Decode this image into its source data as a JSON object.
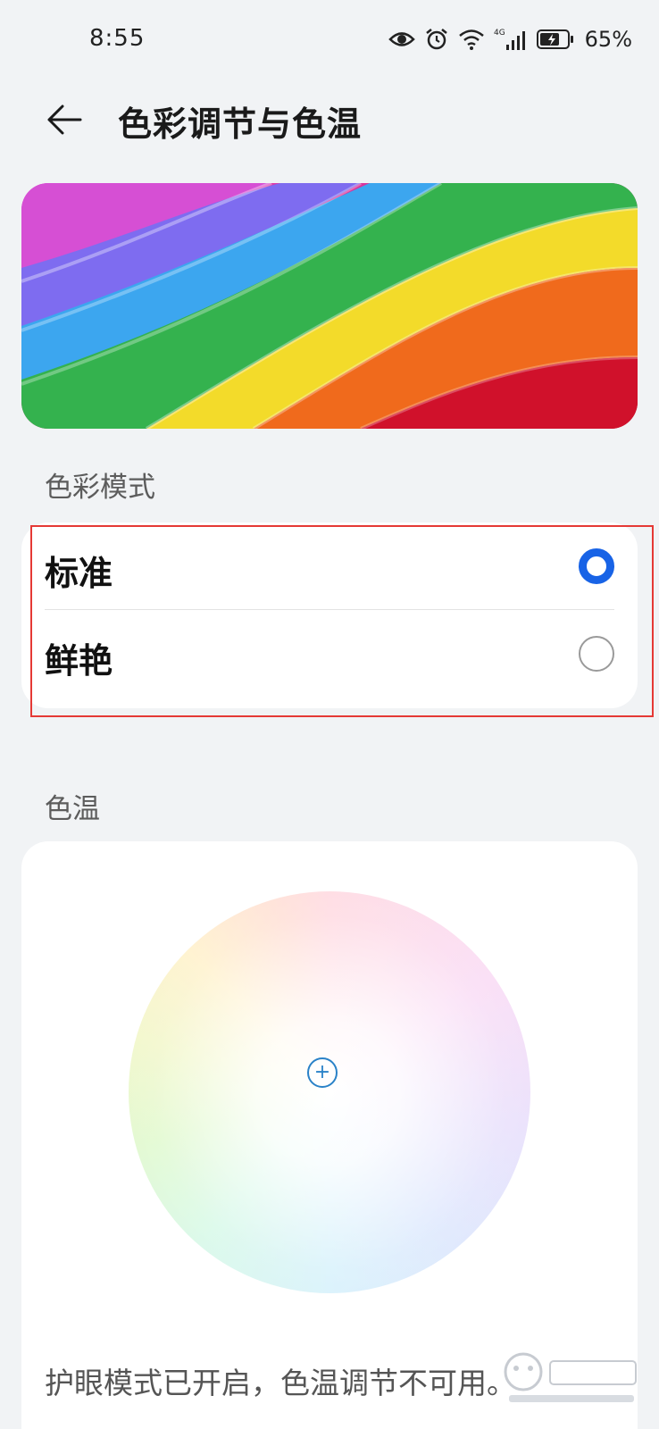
{
  "status_bar": {
    "time": "8:55",
    "network": "4G",
    "battery_percent": "65%",
    "icons": [
      "eye-icon",
      "alarm-icon",
      "wifi-icon",
      "signal-icon",
      "battery-icon"
    ]
  },
  "header": {
    "back_icon": "back-arrow-icon",
    "title": "色彩调节与色温"
  },
  "color_mode": {
    "section_label": "色彩模式",
    "options": [
      {
        "label": "标准",
        "selected": true
      },
      {
        "label": "鲜艳",
        "selected": false
      }
    ]
  },
  "color_temperature": {
    "section_label": "色温",
    "center_symbol": "+",
    "note": "护眼模式已开启，色温调节不可用。"
  },
  "colors": {
    "accent": "#1863e6",
    "background": "#f1f3f5",
    "card": "#ffffff",
    "highlight_border": "#e53935"
  }
}
